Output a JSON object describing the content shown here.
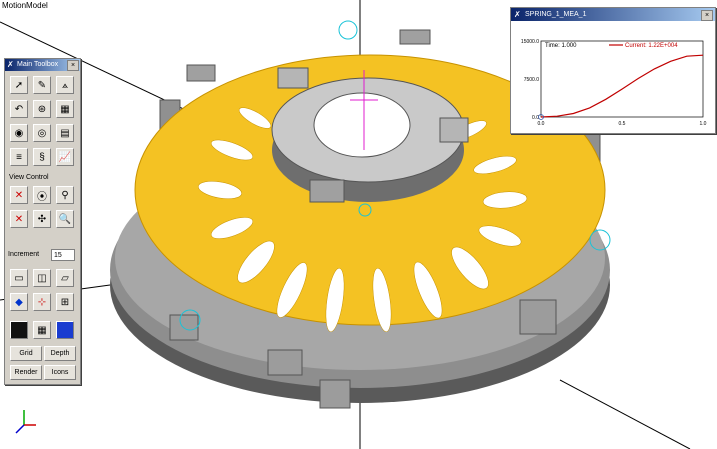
{
  "app": {
    "model_title": "MotionModel"
  },
  "toolbox": {
    "title": "Main Toolbox",
    "view_control_label": "View Control",
    "increment_label": "Increment",
    "increment_value": "15",
    "grid_label": "Grid",
    "depth_label": "Depth",
    "render_label": "Render",
    "icons_label": "Icons"
  },
  "plot_window": {
    "title": "SPRING_1_MEA_1",
    "time_label": "Time:  1.000",
    "current_label": "Current:  1.22E+004"
  },
  "chart_data": {
    "type": "line",
    "title": "",
    "xlabel": "",
    "ylabel": "",
    "xlim": [
      0.0,
      1.0
    ],
    "ylim": [
      0.0,
      15000.0
    ],
    "x_ticks": [
      "0.0",
      "0.5",
      "1.0"
    ],
    "y_ticks": [
      "0.0",
      "7500.0",
      "15000.0"
    ],
    "grid": false,
    "legend": "top-right",
    "series": [
      {
        "name": "Current",
        "color": "#c00000",
        "x": [
          0.0,
          0.1,
          0.2,
          0.3,
          0.4,
          0.5,
          0.6,
          0.7,
          0.8,
          0.9,
          1.0
        ],
        "y": [
          0,
          150,
          700,
          1800,
          3500,
          5500,
          7600,
          9500,
          11000,
          12000,
          12200
        ]
      }
    ]
  },
  "colors": {
    "plate": "#f4c223",
    "metal": "#9a9a9a",
    "accent": "#c00000"
  },
  "icons": {
    "select": "arrow-icon",
    "edit": "pencil-icon",
    "measure": "compass-icon",
    "undo": "undo-icon",
    "table": "table-icon",
    "calculator": "calculator-icon",
    "stats": "info-icon",
    "plot": "plot-icon",
    "axes": "triad-icon"
  }
}
